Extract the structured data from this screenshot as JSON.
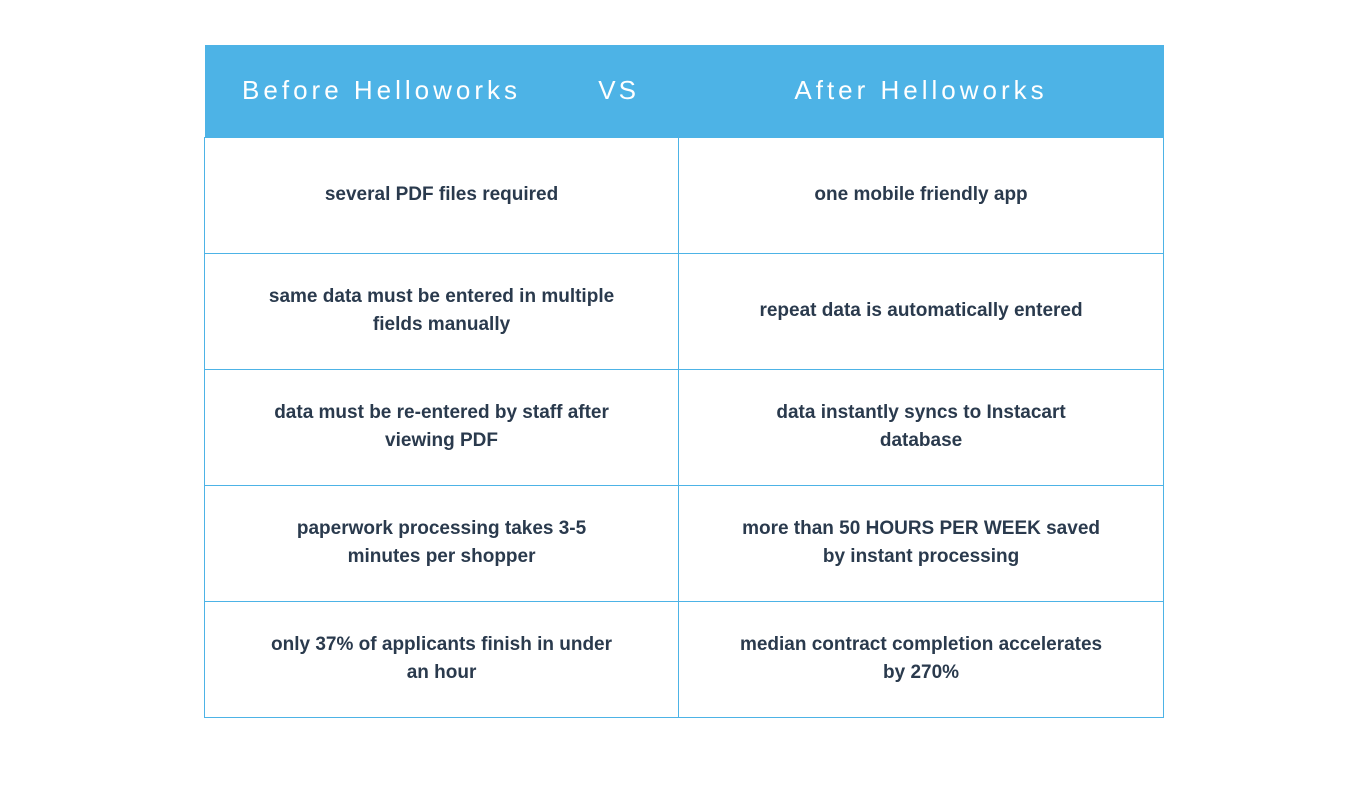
{
  "header": {
    "before": "Before Helloworks",
    "vs": "VS",
    "after": "After Helloworks"
  },
  "rows": [
    {
      "before": "several PDF files required",
      "after": "one mobile friendly app"
    },
    {
      "before": "same data must be entered in multiple fields manually",
      "after": "repeat data is automatically entered"
    },
    {
      "before": "data must be re-entered by staff after viewing PDF",
      "after": "data instantly syncs to Instacart database"
    },
    {
      "before": "paperwork processing takes 3-5 minutes per shopper",
      "after": "more than 50 HOURS PER WEEK saved by instant processing"
    },
    {
      "before": "only 37% of applicants finish in under an hour",
      "after": "median contract completion accelerates by 270%"
    }
  ]
}
